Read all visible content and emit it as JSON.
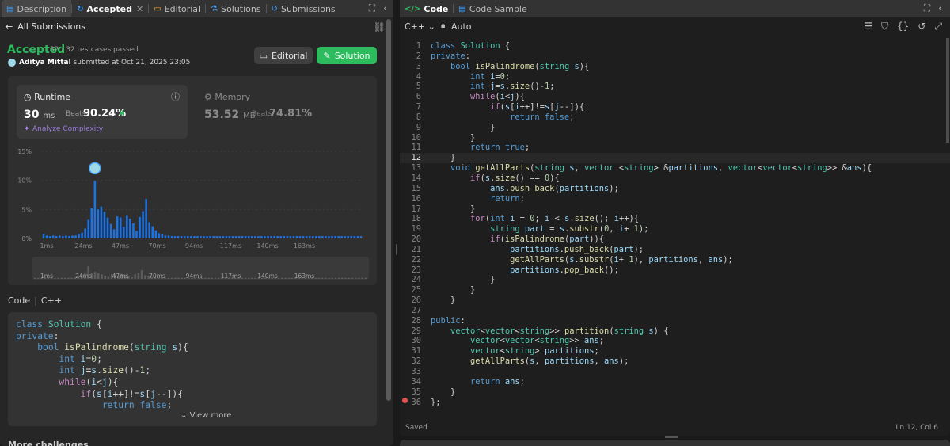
{
  "left_tabs": [
    {
      "label": "Description",
      "icon": "description-icon"
    },
    {
      "label": "Accepted",
      "icon": "accepted-icon"
    },
    {
      "label": "Editorial",
      "icon": "editorial-icon"
    },
    {
      "label": "Solutions",
      "icon": "solutions-icon"
    },
    {
      "label": "Submissions",
      "icon": "submissions-icon"
    }
  ],
  "back_link": "All Submissions",
  "result": {
    "status": "Accepted",
    "testcases": "32 / 32 testcases passed",
    "user": "Aditya Mittal",
    "submitted_text": "submitted at Oct 21, 2025 23:05"
  },
  "buttons": {
    "editorial": "Editorial",
    "solution": "Solution"
  },
  "runtime": {
    "label": "Runtime",
    "value": "30",
    "unit": "ms",
    "beats_label": "Beats",
    "beats_value": "90.24%",
    "analyze": "Analyze Complexity"
  },
  "memory": {
    "label": "Memory",
    "value": "53.52",
    "unit": "MB",
    "beats_label": "Beats",
    "beats_value": "74.81%"
  },
  "chart_data": {
    "type": "bar",
    "y_ticks": [
      "15%",
      "10%",
      "5%",
      "0%"
    ],
    "ylim": [
      0,
      15
    ],
    "x_ticks": [
      "1ms",
      "24ms",
      "47ms",
      "70ms",
      "94ms",
      "117ms",
      "140ms",
      "163ms"
    ],
    "highlight_index": 16,
    "values": [
      0.8,
      0.5,
      0.4,
      0.5,
      0.4,
      0.5,
      0.4,
      0.5,
      0.4,
      0.5,
      0.5,
      0.8,
      1.0,
      1.7,
      3.2,
      5.2,
      9.9,
      5.0,
      5.5,
      4.6,
      3.6,
      2.5,
      1.6,
      3.8,
      3.6,
      2.0,
      3.9,
      3.4,
      2.6,
      1.3,
      3.7,
      4.7,
      6.8,
      2.8,
      2.1,
      1.4,
      0.9,
      0.7,
      0.5,
      0.5,
      0.4,
      0.4,
      0.4,
      0.4,
      0.4,
      0.4,
      0.4,
      0.4,
      0.4,
      0.4,
      0.4,
      0.4,
      0.4,
      0.4,
      0.4,
      0.4,
      0.4,
      0.4,
      0.4,
      0.4,
      0.4,
      0.4,
      0.4,
      0.4,
      0.4,
      0.4,
      0.4,
      0.4,
      0.4,
      0.4,
      0.4,
      0.4,
      0.4,
      0.4,
      0.4,
      0.4,
      0.4,
      0.4,
      0.4,
      0.4,
      0.4,
      0.4,
      0.4,
      0.4,
      0.4,
      0.4,
      0.4,
      0.4,
      0.4,
      0.4,
      0.4,
      0.4,
      0.4,
      0.4,
      0.4,
      0.4,
      0.4,
      0.4,
      0.4,
      0.4
    ]
  },
  "code_section": {
    "label": "Code",
    "lang": "C++",
    "view_more": "View more"
  },
  "left_code_lines": [
    "class Solution {",
    "private:",
    "    bool isPalindrome(string s){",
    "        int i=0;",
    "        int j=s.size()-1;",
    "        while(i<j){",
    "            if(s[i++]!=s[j--]){",
    "                return false;"
  ],
  "more_challenges": "More challenges",
  "right_tabs": [
    {
      "label": "Code",
      "icon": "code-icon"
    },
    {
      "label": "Code Sample",
      "icon": "code-sample-icon"
    }
  ],
  "editor": {
    "language": "C++",
    "mode": "Auto",
    "status": "Saved",
    "cursor": "Ln 12, Col 6",
    "current_line": 12,
    "lines": [
      "class Solution {",
      "private:",
      "    bool isPalindrome(string s){",
      "        int i=0;",
      "        int j=s.size()-1;",
      "        while(i<j){",
      "            if(s[i++]!=s[j--]){",
      "                return false;",
      "            }",
      "        }",
      "        return true;",
      "    }",
      "    void getAllParts(string s, vector <string> &partitions, vector<vector<string>> &ans){",
      "        if(s.size() == 0){",
      "            ans.push_back(partitions);",
      "            return;",
      "        }",
      "        for(int i = 0; i < s.size(); i++){",
      "            string part = s.substr(0, i+ 1);",
      "            if(isPalindrome(part)){",
      "                partitions.push_back(part);",
      "                getAllParts(s.substr(i+ 1), partitions, ans);",
      "                partitions.pop_back();",
      "            }",
      "        }",
      "    }",
      "",
      "public:",
      "    vector<vector<string>> partition(string s) {",
      "        vector<vector<string>> ans;",
      "        vector<string> partitions;",
      "        getAllParts(s, partitions, ans);",
      "",
      "        return ans;",
      "    }",
      "};"
    ]
  },
  "colors": {
    "accepted": "#2cbb5d",
    "bar": "#1a73e8",
    "bar_dim": "#3b6fb5",
    "breakpoint": "#e35050"
  }
}
